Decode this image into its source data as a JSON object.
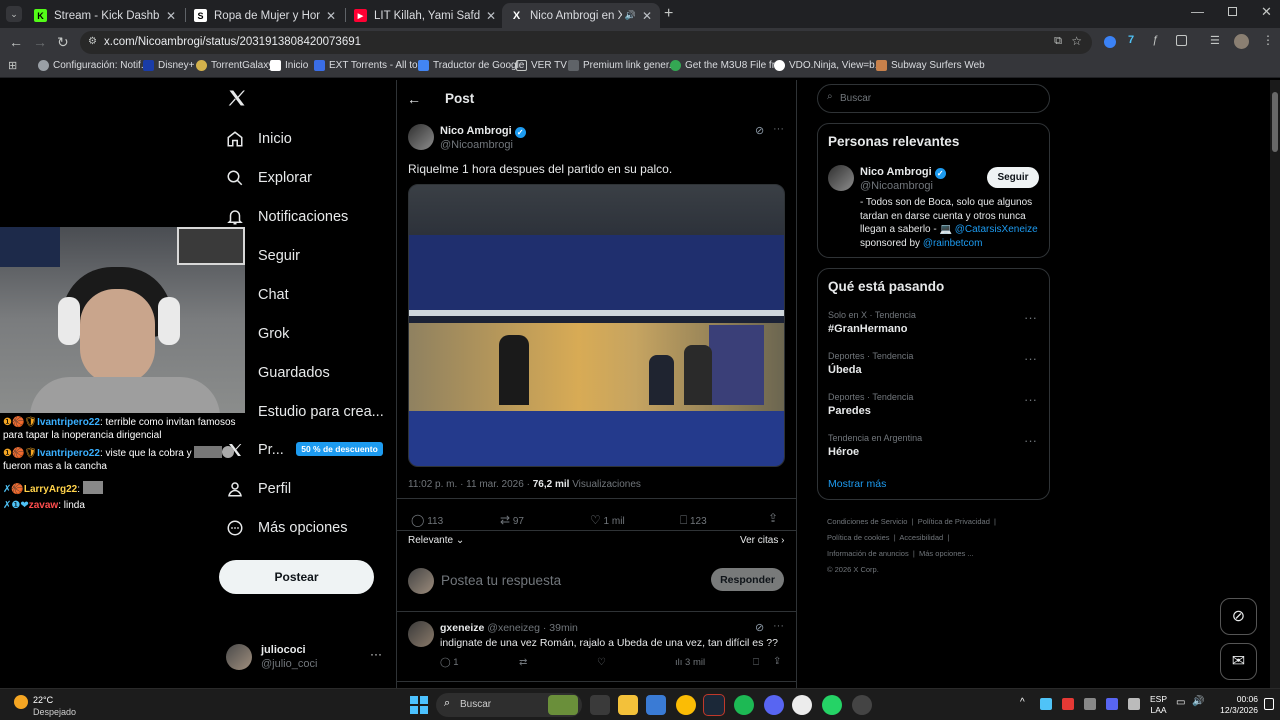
{
  "browser": {
    "tabs": [
      {
        "title": "Stream - Kick Dashboard",
        "favicon_color": "#53fc18",
        "favicon_letter": "K"
      },
      {
        "title": "Ropa de Mujer y Hombre, Com",
        "favicon_color": "#ffffff",
        "favicon_letter": "S"
      },
      {
        "title": "LIT Killah, Yami Safdie, Big One",
        "favicon_color": "#ff0033",
        "favicon_letter": "▶"
      },
      {
        "title": "Nico Ambrogi en X: \"Riquel",
        "favicon_color": "#ffffff",
        "favicon_letter": "X"
      }
    ],
    "url": "x.com/Nicoambrogi/status/2031913808420073691",
    "bookmarks": [
      "Configuración: Notif...",
      "Disney+",
      "TorrentGalaxy",
      "Inicio",
      "EXT Torrents - All to...",
      "Traductor de Google",
      "VER TV",
      "Premium link gener...",
      "Get the M3U8 File fr...",
      "VDO.Ninja, View=b...",
      "Subway Surfers Web"
    ]
  },
  "sidebar": {
    "items": [
      {
        "label": "Inicio",
        "icon": "home-icon"
      },
      {
        "label": "Explorar",
        "icon": "search-icon"
      },
      {
        "label": "Notificaciones",
        "icon": "bell-icon"
      },
      {
        "label": "Seguir",
        "icon": "follow-icon"
      },
      {
        "label": "Chat",
        "icon": "chat-icon"
      },
      {
        "label": "Grok",
        "icon": "grok-icon"
      },
      {
        "label": "Guardados",
        "icon": "bookmark-icon"
      },
      {
        "label": "Estudio para crea...",
        "icon": "studio-icon"
      },
      {
        "label": "Pr...",
        "icon": "x-logo-icon"
      },
      {
        "label": "Perfil",
        "icon": "profile-icon"
      },
      {
        "label": "Más opciones",
        "icon": "more-icon"
      }
    ],
    "premium_badge": "50 % de descuento",
    "post_button": "Postear",
    "account": {
      "name": "juliococi",
      "handle": "@julio_coci"
    }
  },
  "post": {
    "header": "Post",
    "author": {
      "name": "Nico Ambrogi",
      "handle": "@Nicoambrogi"
    },
    "text": "Riquelme 1 hora despues del partido en su palco.",
    "timestamp": "11:02 p. m. · 11 mar. 2026 ·",
    "views": "76,2 mil",
    "views_label": "Visualizaciones",
    "stats": {
      "replies": "113",
      "reposts": "97",
      "likes": "1 mil",
      "bookmarks": "123"
    },
    "sort_label": "Relevante",
    "quotes_label": "Ver citas",
    "reply_placeholder": "Postea tu respuesta",
    "reply_button": "Responder",
    "reply": {
      "name": "gxeneize",
      "handle": "@xeneizeg · 39min",
      "text": "indignate de una vez Román, rajalo a Ubeda de una vez, tan difícil es ??",
      "replies": "1",
      "views": "3 mil"
    }
  },
  "right": {
    "search_placeholder": "Buscar",
    "relevant_title": "Personas relevantes",
    "relevant": {
      "name": "Nico Ambrogi",
      "handle": "@Nicoambrogi",
      "follow": "Seguir",
      "bio1": "- Todos son de Boca, solo que algunos",
      "bio2": "tardan en darse cuenta y otros nunca",
      "bio3": "llegan a saberlo -",
      "bio_link": "@CatarsisXeneize",
      "bio4": "sponsored by",
      "bio_link2": "@rainbetcom"
    },
    "trending_title": "Qué está pasando",
    "trends": [
      {
        "context": "Solo en X · Tendencia",
        "name": "#GranHermano"
      },
      {
        "context": "Deportes · Tendencia",
        "name": "Úbeda"
      },
      {
        "context": "Deportes · Tendencia",
        "name": "Paredes"
      },
      {
        "context": "Tendencia en Argentina",
        "name": "Héroe"
      }
    ],
    "show_more": "Mostrar más",
    "footer": [
      "Condiciones de Servicio",
      "Política de Privacidad",
      "Política de cookies",
      "Accesibilidad",
      "Información de anuncios",
      "Más opciones ...",
      "© 2026 X Corp."
    ]
  },
  "stream_chat": [
    {
      "user": "Ivantripero22",
      "text": ": terrible como invitan famosos para tapar la inoperancia dirigencial",
      "color": "#3ab0ff"
    },
    {
      "user": "Ivantripero22",
      "text": ": viste que la cobra y",
      "text2": "fueron mas a la cancha",
      "color": "#3ab0ff"
    },
    {
      "user": "LarryArg22",
      "text": ":",
      "color": "#ffd24a"
    },
    {
      "user": "zavaw",
      "text": ": linda",
      "color": "#ff4d4d"
    }
  ],
  "taskbar": {
    "weather_temp": "22°C",
    "weather_desc": "Despejado",
    "search": "Buscar",
    "lang1": "ESP",
    "lang2": "LAA",
    "time": "00:06",
    "date": "12/3/2026"
  }
}
